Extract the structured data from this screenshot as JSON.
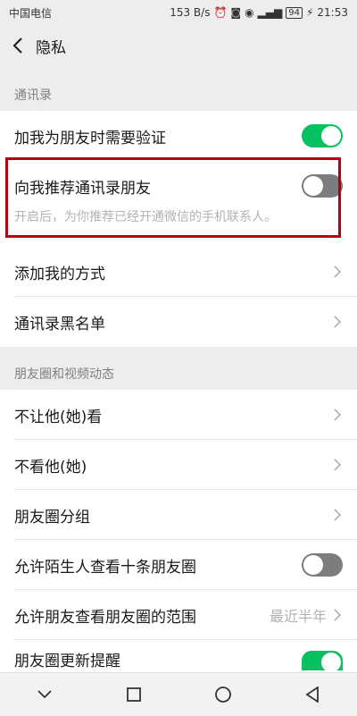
{
  "status_bar": {
    "carrier": "中国电信",
    "speed": "153 B/s",
    "battery": "94",
    "time": "21:53"
  },
  "header": {
    "title": "隐私"
  },
  "sections": {
    "contacts": {
      "header": "通讯录",
      "verify_label": "加我为朋友时需要验证",
      "verify_on": true,
      "recommend_label": "向我推荐通讯录朋友",
      "recommend_on": false,
      "recommend_desc": "开启后，为你推荐已经开通微信的手机联系人。",
      "add_methods_label": "添加我的方式",
      "blacklist_label": "通讯录黑名单"
    },
    "moments": {
      "header": "朋友圈和视频动态",
      "hide_from_label": "不让他(她)看",
      "dont_see_label": "不看他(她)",
      "groups_label": "朋友圈分组",
      "strangers_label": "允许陌生人查看十条朋友圈",
      "strangers_on": false,
      "range_label": "允许朋友查看朋友圈的范围",
      "range_value": "最近半年",
      "update_reminder_label": "朋友圈更新提醒",
      "update_reminder_on": true
    }
  },
  "colors": {
    "toggle_on": "#07c160",
    "toggle_off": "#7d7d7d",
    "highlight": "#b3000e"
  }
}
